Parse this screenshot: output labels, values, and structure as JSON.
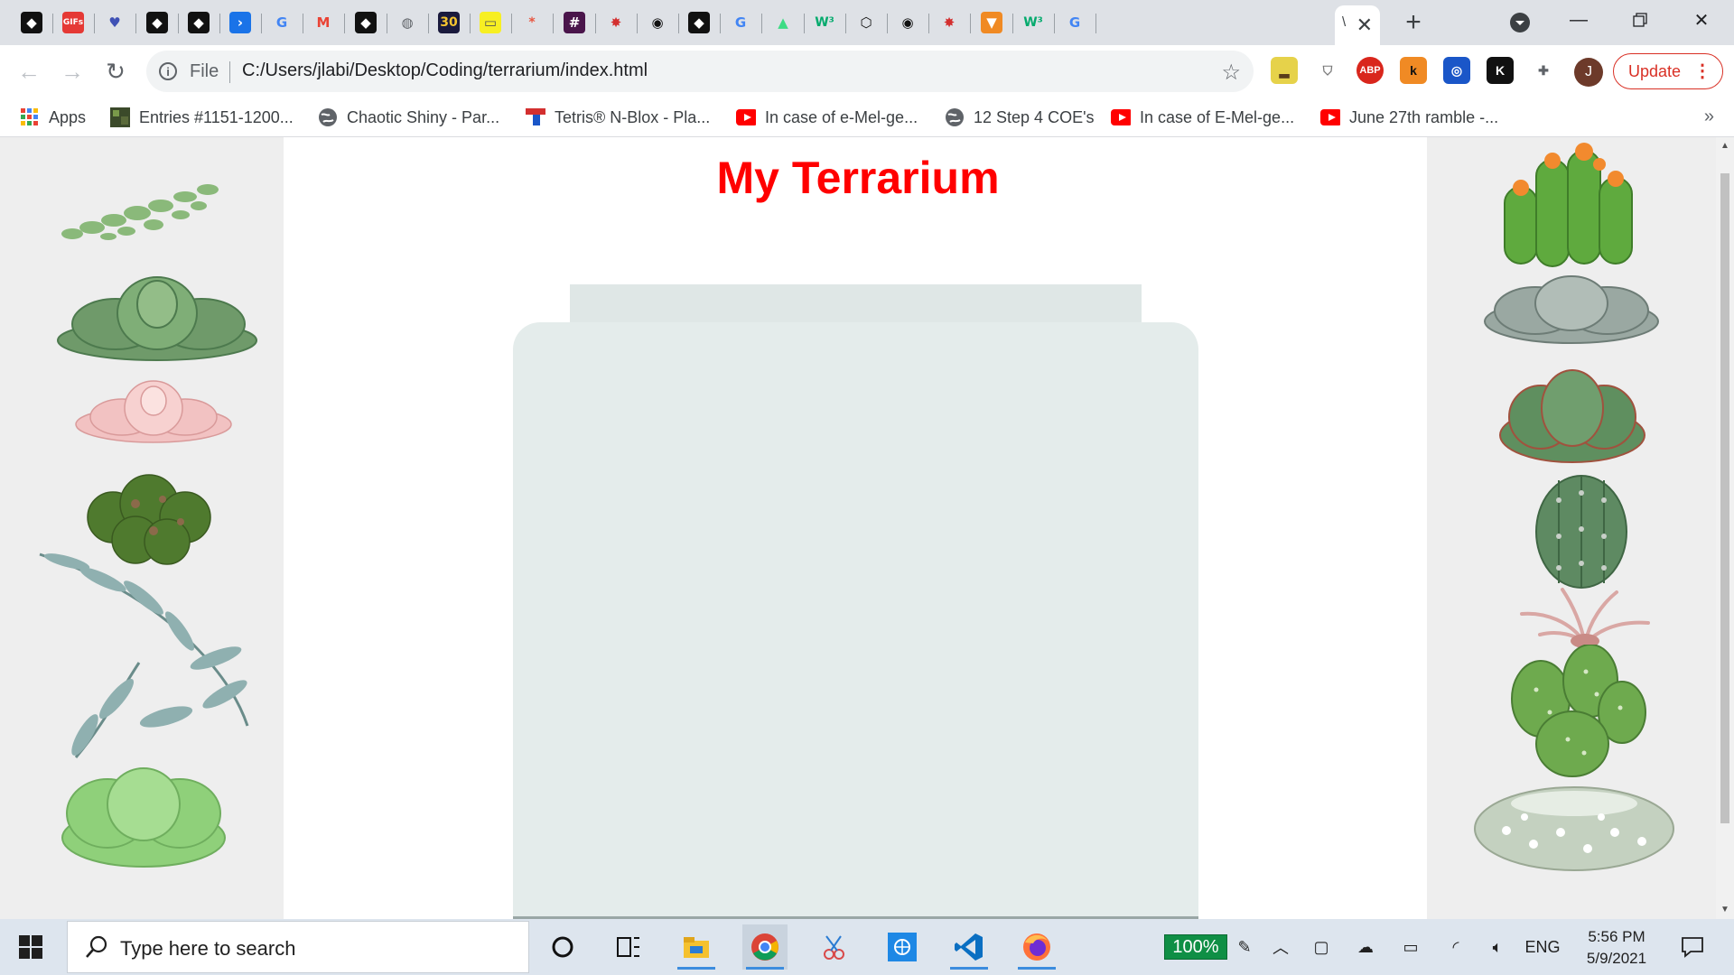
{
  "window": {
    "tabs": [
      {
        "icon": "pen-logo-icon"
      },
      {
        "icon": "gifs-icon",
        "text": "GIFs"
      },
      {
        "icon": "blue-heart-icon"
      },
      {
        "icon": "pen-logo-icon"
      },
      {
        "icon": "pen-logo-icon"
      },
      {
        "icon": "terminal-icon"
      },
      {
        "icon": "google-icon"
      },
      {
        "icon": "gmail-icon"
      },
      {
        "icon": "pen-logo-icon"
      },
      {
        "icon": "globe-icon"
      },
      {
        "icon": "thirty-icon",
        "text": "30"
      },
      {
        "icon": "yellow-note-icon"
      },
      {
        "icon": "asterisk-icon",
        "text": "*"
      },
      {
        "icon": "slack-icon"
      },
      {
        "icon": "star-burst-icon"
      },
      {
        "icon": "github-icon"
      },
      {
        "icon": "pen-logo-icon"
      },
      {
        "icon": "google-icon"
      },
      {
        "icon": "android-icon"
      },
      {
        "icon": "w3schools-icon",
        "text": "W³"
      },
      {
        "icon": "codepen-icon"
      },
      {
        "icon": "github-icon"
      },
      {
        "icon": "star-burst-icon"
      },
      {
        "icon": "fox-icon"
      },
      {
        "icon": "w3schools-icon",
        "text": "W³"
      },
      {
        "icon": "google-icon"
      }
    ],
    "active_tab_title": "\\",
    "new_tab_label": "+"
  },
  "toolbar": {
    "scheme_label": "File",
    "url": "C:/Users/jlabi/Desktop/Coding/terrarium/index.html",
    "profile_initial": "J",
    "update_label": "Update"
  },
  "extensions": [
    {
      "icon": "terrarium-extension-icon"
    },
    {
      "icon": "shield-extension-icon"
    },
    {
      "icon": "adblock-plus-icon",
      "text": "ABP"
    },
    {
      "icon": "k-extension-icon",
      "text": "k"
    },
    {
      "icon": "swirl-extension-icon"
    },
    {
      "icon": "k-black-extension-icon",
      "text": "K"
    },
    {
      "icon": "puzzle-extensions-icon"
    }
  ],
  "bookmarks": [
    {
      "label": "Apps",
      "icon": "apps-grid-icon"
    },
    {
      "label": "Entries #1151-1200...",
      "icon": "entries-thumb-icon"
    },
    {
      "label": "Chaotic Shiny - Par...",
      "icon": "globe-icon"
    },
    {
      "label": "Tetris® N-Blox - Pla...",
      "icon": "tetris-icon"
    },
    {
      "label": "In case of e-Mel-ge...",
      "icon": "youtube-icon"
    },
    {
      "label": "12 Step 4 COE's",
      "icon": "globe-icon"
    },
    {
      "label": "In case of E-Mel-ge...",
      "icon": "youtube-icon"
    },
    {
      "label": "June 27th ramble -...",
      "icon": "youtube-icon"
    }
  ],
  "page": {
    "title": "My Terrarium",
    "title_color": "#ff0000"
  },
  "taskbar": {
    "search_placeholder": "Type here to search",
    "apps": [
      "cortana-icon",
      "task-view-icon",
      "file-explorer-icon",
      "chrome-icon",
      "snip-icon",
      "network-app-icon",
      "vscode-icon",
      "firefox-icon"
    ],
    "zoom_badge": "100%",
    "language": "ENG",
    "time": "5:56 PM",
    "date": "5/9/2021"
  },
  "colors": {
    "accent_red": "#d93025",
    "jar": "#e4eceb",
    "plant_panel": "#eeeeee"
  }
}
